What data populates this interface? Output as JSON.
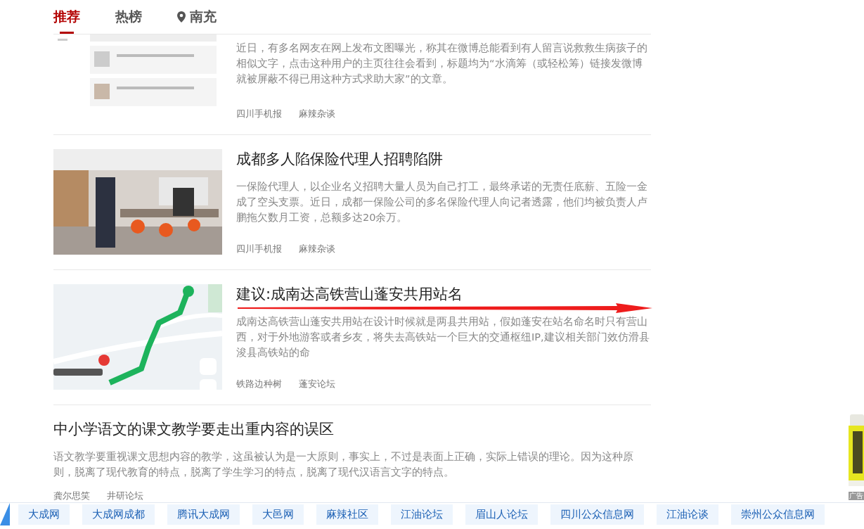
{
  "tabs": [
    {
      "label": "推荐",
      "selected": true,
      "kind": "text"
    },
    {
      "label": "热榜",
      "selected": false,
      "kind": "text"
    },
    {
      "label": "南充",
      "selected": false,
      "kind": "location"
    }
  ],
  "articles": [
    {
      "kind": "picture",
      "summary": "近日，有多名网友在网上发布文图曝光，称其在微博总能看到有人留言说救救生病孩子的相似文字，点击这种用户的主页往往会看到，标题均为“水滴筹（或轻松筹）链接发微博就被屏蔽不得已用这种方式求助大家”的文章。",
      "sources": [
        "四川手机报",
        "麻辣杂谈"
      ]
    },
    {
      "kind": "picture",
      "title": "成都多人陷保险代理人招聘陷阱",
      "summary": "一保险代理人，以企业名义招聘大量人员为自己打工，最终承诺的无责任底薪、五险一金成了空头支票。近日，成都一保险公司的多名保险代理人向记者透露，他们均被负责人卢鹏拖欠数月工资，总额多达20余万。",
      "sources": [
        "四川手机报",
        "麻辣杂谈"
      ]
    },
    {
      "kind": "picture",
      "title": "建议:成南达高铁营山蓬安共用站名",
      "summary": "成南达高铁营山蓬安共用站在设计时候就是两县共用站，假如蓬安在站名命名时只有营山西，对于外地游客或者乡友，将失去高铁站一个巨大的交通枢纽IP,建议相关部门效仿滑县浚县高铁站的命",
      "sources": [
        "铁路边种树",
        "蓬安论坛"
      ]
    },
    {
      "kind": "text",
      "title": "中小学语文的课文教学要走出重内容的误区",
      "summary": "语文教学要重视课文思想内容的教学，这虽被认为是一大原则，事实上，不过是表面上正确，实际上错误的理论。因为这种原则，脱离了现代教育的特点，脱离了学生学习的特点，脱离了现代汉语言文字的特点。",
      "sources": [
        "龚尔思笑",
        "井研论坛"
      ]
    }
  ],
  "ad": {
    "label": "广告"
  },
  "links": [
    "大成网",
    "大成网成都",
    "腾讯大成网",
    "大邑网",
    "麻辣社区",
    "江油论坛",
    "眉山人论坛",
    "四川公众信息网",
    "江油论谈",
    "崇州公众信息网"
  ]
}
